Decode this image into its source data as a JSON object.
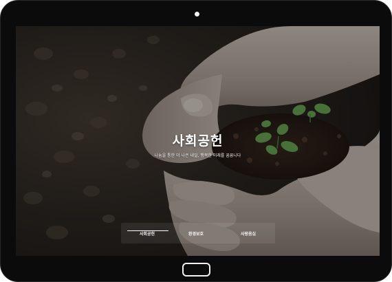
{
  "hero": {
    "title": "사회공헌",
    "subtitle": "나눔을 통한 더 나은 내일, 행복한 미래를 꿈꿉니다"
  },
  "tabs": [
    {
      "label": "사회공헌",
      "active": true
    },
    {
      "label": "환경보호",
      "active": false
    },
    {
      "label": "사랑음심",
      "active": false
    }
  ],
  "colors": {
    "bezel": "#0b0b0b",
    "overlay": "rgba(0,0,0,0.35)",
    "text": "#ffffff"
  }
}
